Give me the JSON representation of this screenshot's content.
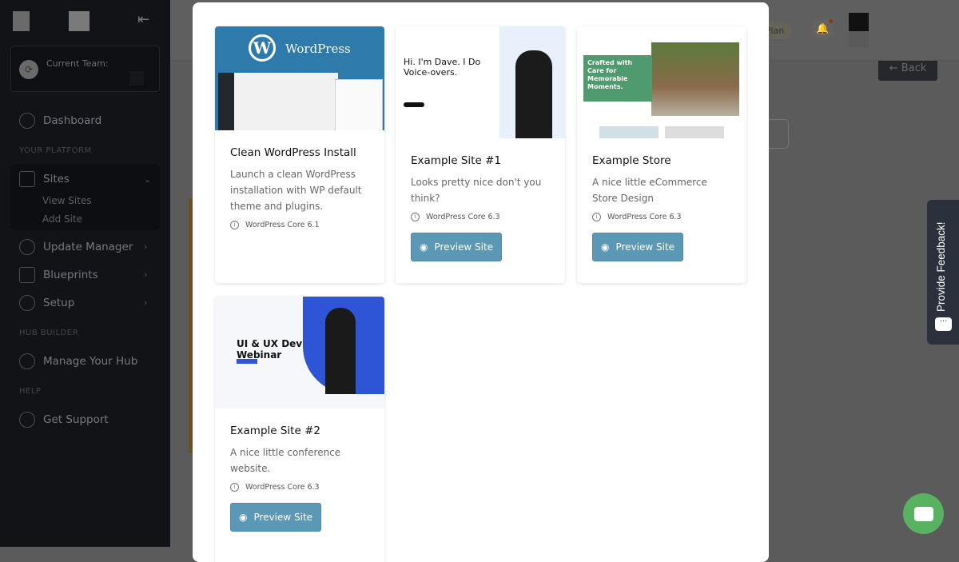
{
  "sidebar": {
    "team_label": "Current Team:",
    "dashboard": "Dashboard",
    "section_platform": "YOUR PLATFORM",
    "sites": "Sites",
    "view_sites": "View Sites",
    "add_site": "Add Site",
    "update_manager": "Update Manager",
    "blueprints": "Blueprints",
    "setup": "Setup",
    "section_hub": "HUB BUILDER",
    "manage_hub": "Manage Your Hub",
    "section_help": "HELP",
    "get_support": "Get Support"
  },
  "header": {
    "plan": "ler Plan",
    "back": "← Back"
  },
  "modal": {
    "cards": [
      {
        "title": "Clean WordPress Install",
        "description": "Launch a clean WordPress installation with WP default theme and plugins.",
        "version": "WordPress Core 6.1",
        "thumb_text": "WordPress"
      },
      {
        "title": "Example Site #1",
        "description": "Looks pretty nice don't you think?",
        "version": "WordPress Core 6.3",
        "button": "Preview Site",
        "thumb_text": "Hi. I'm Dave. I Do Voice-overs."
      },
      {
        "title": "Example Store",
        "description": "A nice little eCommerce Store Design",
        "version": "WordPress Core 6.3",
        "button": "Preview Site",
        "thumb_text": "Crafted with Care for Memorable Moments."
      },
      {
        "title": "Example Site #2",
        "description": "A nice little conference website.",
        "version": "WordPress Core 6.3",
        "button": "Preview Site",
        "thumb_text": "UI & UX Dev Webinar"
      }
    ]
  },
  "feedback": {
    "label": "Provide Feedback!"
  },
  "colors": {
    "accent": "#5a98b6",
    "chat": "#59b25f",
    "sidebar": "#111317"
  }
}
